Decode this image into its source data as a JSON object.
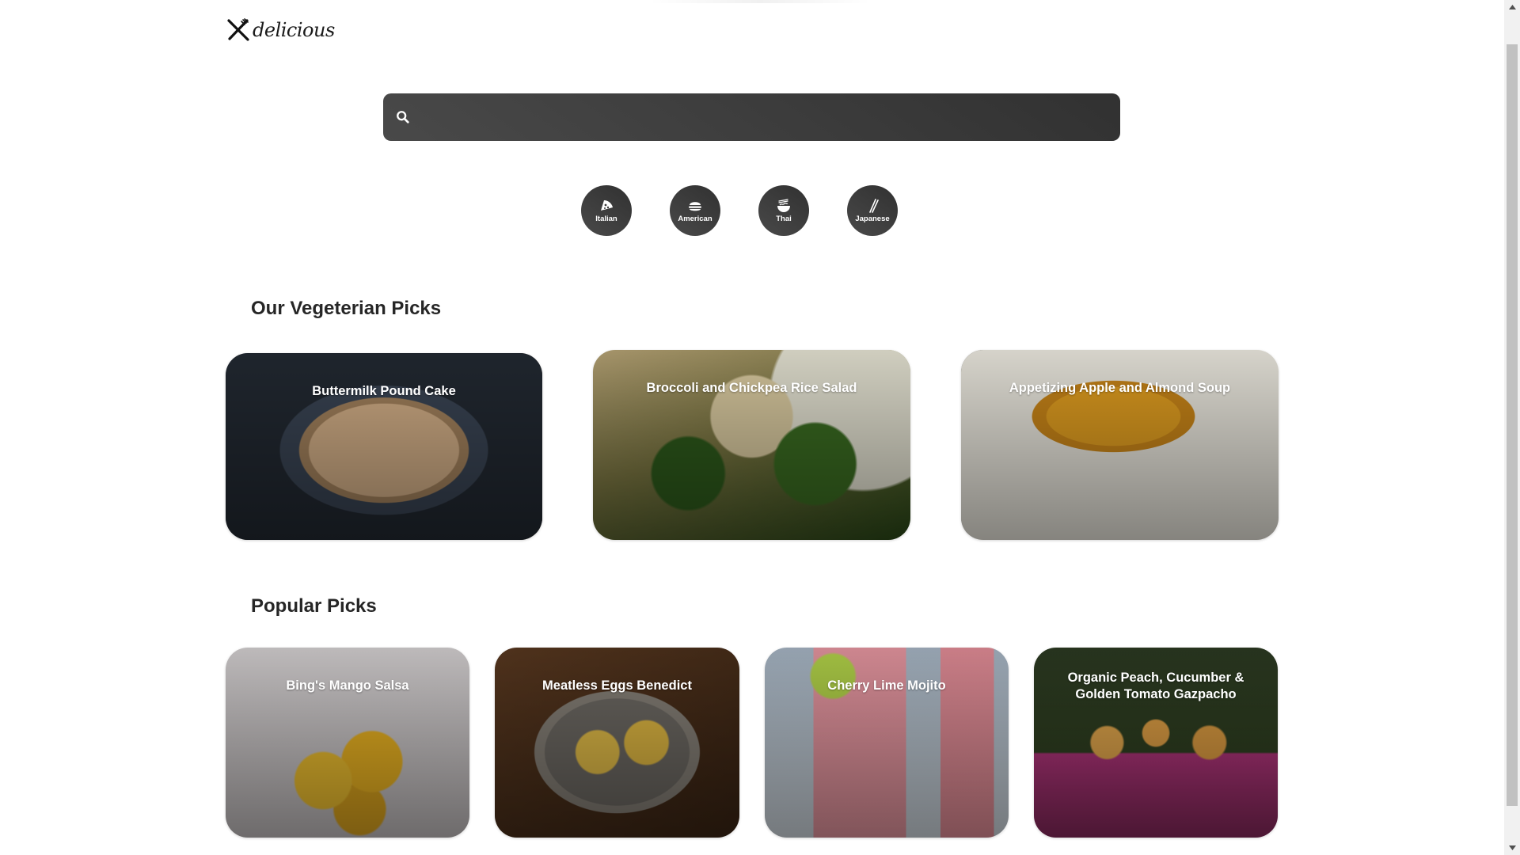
{
  "brand": {
    "name": "delicious"
  },
  "search": {
    "placeholder": "",
    "value": ""
  },
  "cuisines": [
    {
      "label": "Italian",
      "icon": "pizza-icon"
    },
    {
      "label": "American",
      "icon": "burger-icon"
    },
    {
      "label": "Thai",
      "icon": "noodle-bowl-icon"
    },
    {
      "label": "Japanese",
      "icon": "chopsticks-icon"
    }
  ],
  "veggie": {
    "title": "Our Vegeterian Picks",
    "items": [
      {
        "title": "Buttermilk Pound Cake"
      },
      {
        "title": "Broccoli and Chickpea Rice Salad"
      },
      {
        "title": "Appetizing Apple and Almond Soup"
      }
    ]
  },
  "popular": {
    "title": "Popular Picks",
    "items": [
      {
        "title": "Bing's Mango Salsa"
      },
      {
        "title": "Meatless Eggs Benedict"
      },
      {
        "title": "Cherry Lime Mojito"
      },
      {
        "title": "Organic Peach, Cucumber & Golden Tomato Gazpacho"
      }
    ]
  },
  "colors": {
    "control_dark": "#313131",
    "control_light": "#494949",
    "text": "#262626",
    "background": "#ffffff"
  }
}
